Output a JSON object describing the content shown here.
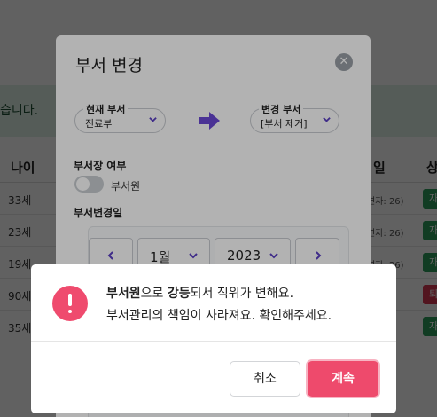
{
  "background": {
    "notice_text": "습니다.",
    "col_age": "나이",
    "col_day": "일",
    "col_state": "상",
    "rows": [
      {
        "age": "33세",
        "info": "면자: 26)",
        "tag": "자",
        "tag_color": "#2e9e5e"
      },
      {
        "age": "23세",
        "info": "면자: 26)",
        "tag": "자",
        "tag_color": "#2e9e5e"
      },
      {
        "age": "19세",
        "info": "면자: 26)",
        "tag": "자",
        "tag_color": "#2e9e5e"
      },
      {
        "age": "90세",
        "info": "1)",
        "tag": "퇴",
        "tag_color": "#d83a52"
      },
      {
        "age": "35세",
        "info": "6)",
        "tag": "자",
        "tag_color": "#2e9e5e"
      }
    ]
  },
  "dept_modal": {
    "title": "부서 변경",
    "close_icon": "close-icon",
    "current_dept_label": "현재 부서",
    "current_dept_value": "진료부",
    "new_dept_label": "변경 부서",
    "new_dept_value": "[부서 제거]",
    "head_section": "부서장 여부",
    "toggle_label": "부서원",
    "toggle_on": false,
    "date_section": "부서변경일",
    "month": "1월",
    "year": "2023",
    "accent": "#6b48d6"
  },
  "confirm": {
    "line1_bold1": "부서원",
    "line1_mid": "으로 ",
    "line1_bold2": "강등",
    "line1_end": "되서 직위가 변해요.",
    "line2": "부서관리의 책임이 사라져요. 확인해주세요.",
    "cancel_label": "취소",
    "continue_label": "계속",
    "icon": "exclamation-icon",
    "accent": "#ee4a6c"
  }
}
